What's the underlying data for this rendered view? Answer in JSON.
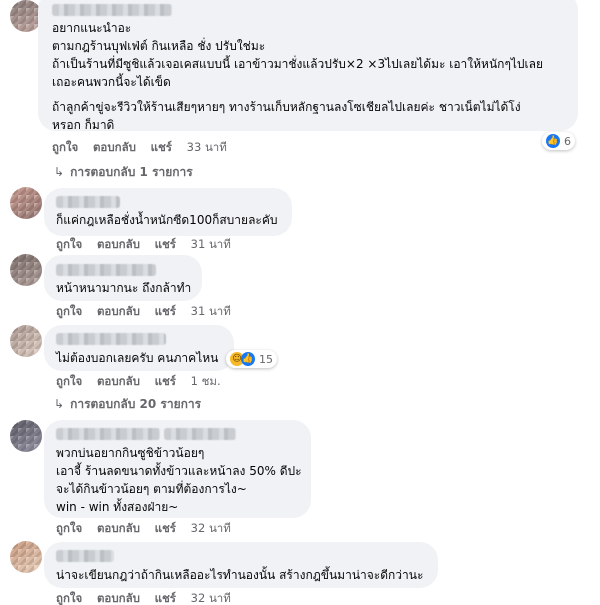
{
  "colors": {
    "bubble": "#f0f2f5",
    "meta_text": "#65676b",
    "like_blue": "#1877f2",
    "haha_yellow": "#f7b928"
  },
  "icons": {
    "like": "like-icon",
    "haha": "haha-icon",
    "reply_arrow": "reply-arrow-icon"
  },
  "actions": {
    "like": "ถูกใจ",
    "reply": "ตอบกลับ",
    "share": "แชร์"
  },
  "comments": [
    {
      "lines": [
        "อยากแนะนำอะ",
        "ตามกฎร้านบุฟเฟ่ต์ กินเหลือ ชั่ง ปรับใช่มะ",
        "ถ้าเป็นร้านที่มีซูชิแล้วเจอเคสแบบนี้ เอาข้าวมาชั่งแล้วปรับ×2 ×3ไปเลยได้มะ เอาให้หนักๆไปเลย",
        "เถอะคนพวกนี้จะได้เข็ด",
        "ถ้าลูกค้าขู่จะรีวิวให้ร้านเสียๆหายๆ ทางร้านเก็บหลักฐานลงโซเชียลไปเลยค่ะ ชาวเน็ตไม่ได้โง่",
        "หรอก ก็มาดิ"
      ],
      "time": "33 นาที",
      "reaction_count": "6",
      "replies_label": "การตอบกลับ 1 รายการ"
    },
    {
      "lines": [
        "ก็แค่กฎเหลือชั่งน้ำหนักซีด100ก็สบายละคับ"
      ],
      "time": "31 นาที"
    },
    {
      "lines": [
        "หน้าหนามากนะ ถึงกล้าทำ"
      ],
      "time": "31 นาที"
    },
    {
      "lines": [
        "ไม่ต้องบอกเลยครับ คนภาคไหน"
      ],
      "time": "1 ชม.",
      "reaction_count": "15",
      "replies_label": "การตอบกลับ 20 รายการ"
    },
    {
      "lines": [
        "พวกบ่นอยากกินซูชิข้าวน้อยๆ",
        "เอาจี้ ร้านลดขนาดทั้งข้าวและหน้าลง 50% ดีปะ",
        "จะได้กินข้าวน้อยๆ ตามที่ต้องการไง~",
        "win - win ทั้งสองฝ่าย~"
      ],
      "time": "32 นาที"
    },
    {
      "lines": [
        "น่าจะเขียนกฎว่าถ้ากินเหลืออะไรทำนองนั้น สร้างกฎขึ้นมาน่าจะดีกว่านะ"
      ],
      "time": "32 นาที"
    }
  ]
}
